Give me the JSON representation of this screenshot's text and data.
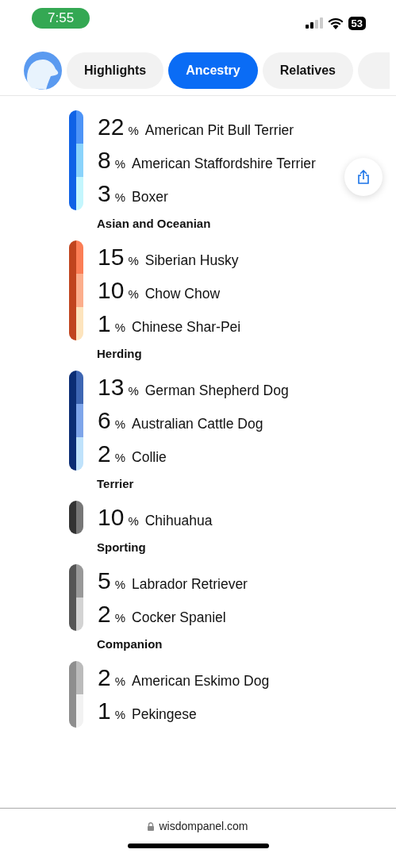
{
  "status_bar": {
    "time": "7:55",
    "battery": "53"
  },
  "tabs": [
    {
      "label": "Highlights",
      "selected": false
    },
    {
      "label": "Ancestry",
      "selected": true
    },
    {
      "label": "Relatives",
      "selected": false
    }
  ],
  "groups": [
    {
      "color": "#0f62e6",
      "breeds": [
        {
          "percent": "22",
          "unit": "%",
          "name": "American Pit Bull Terrier",
          "color": "#4d94f7"
        },
        {
          "percent": "8",
          "unit": "%",
          "name": "American Staffordshire Terrier",
          "color": "#8ad3fb"
        },
        {
          "percent": "3",
          "unit": "%",
          "name": "Boxer",
          "color": "#c4f6fd"
        }
      ]
    },
    {
      "name": "Asian and Oceanian",
      "color": "#c0441e",
      "breeds": [
        {
          "percent": "15",
          "unit": "%",
          "name": "Siberian Husky",
          "color": "#fb7e56"
        },
        {
          "percent": "10",
          "unit": "%",
          "name": "Chow Chow",
          "color": "#fcae8c"
        },
        {
          "percent": "1",
          "unit": "%",
          "name": "Chinese Shar-Pei",
          "color": "#fde4bd"
        }
      ]
    },
    {
      "name": "Herding",
      "color": "#0b2d74",
      "breeds": [
        {
          "percent": "13",
          "unit": "%",
          "name": "German Shepherd Dog",
          "color": "#3e66b3"
        },
        {
          "percent": "6",
          "unit": "%",
          "name": "Australian Cattle Dog",
          "color": "#7ea5ea"
        },
        {
          "percent": "2",
          "unit": "%",
          "name": "Collie",
          "color": "#bfe2fb"
        }
      ]
    },
    {
      "name": "Terrier",
      "color": "#333333",
      "breeds": [
        {
          "percent": "10",
          "unit": "%",
          "name": "Chihuahua",
          "color": "#777777"
        }
      ]
    },
    {
      "name": "Sporting",
      "color": "#555555",
      "breeds": [
        {
          "percent": "5",
          "unit": "%",
          "name": "Labrador Retriever",
          "color": "#999999"
        },
        {
          "percent": "2",
          "unit": "%",
          "name": "Cocker Spaniel",
          "color": "#d3d3d3"
        }
      ]
    },
    {
      "name": "Companion",
      "color": "#8e8e8e",
      "breeds": [
        {
          "percent": "2",
          "unit": "%",
          "name": "American Eskimo Dog",
          "color": "#bbbbbb"
        },
        {
          "percent": "1",
          "unit": "%",
          "name": "Pekingese",
          "color": "#f2f2f2"
        }
      ]
    }
  ],
  "address_bar": {
    "url": "wisdompanel.com"
  }
}
